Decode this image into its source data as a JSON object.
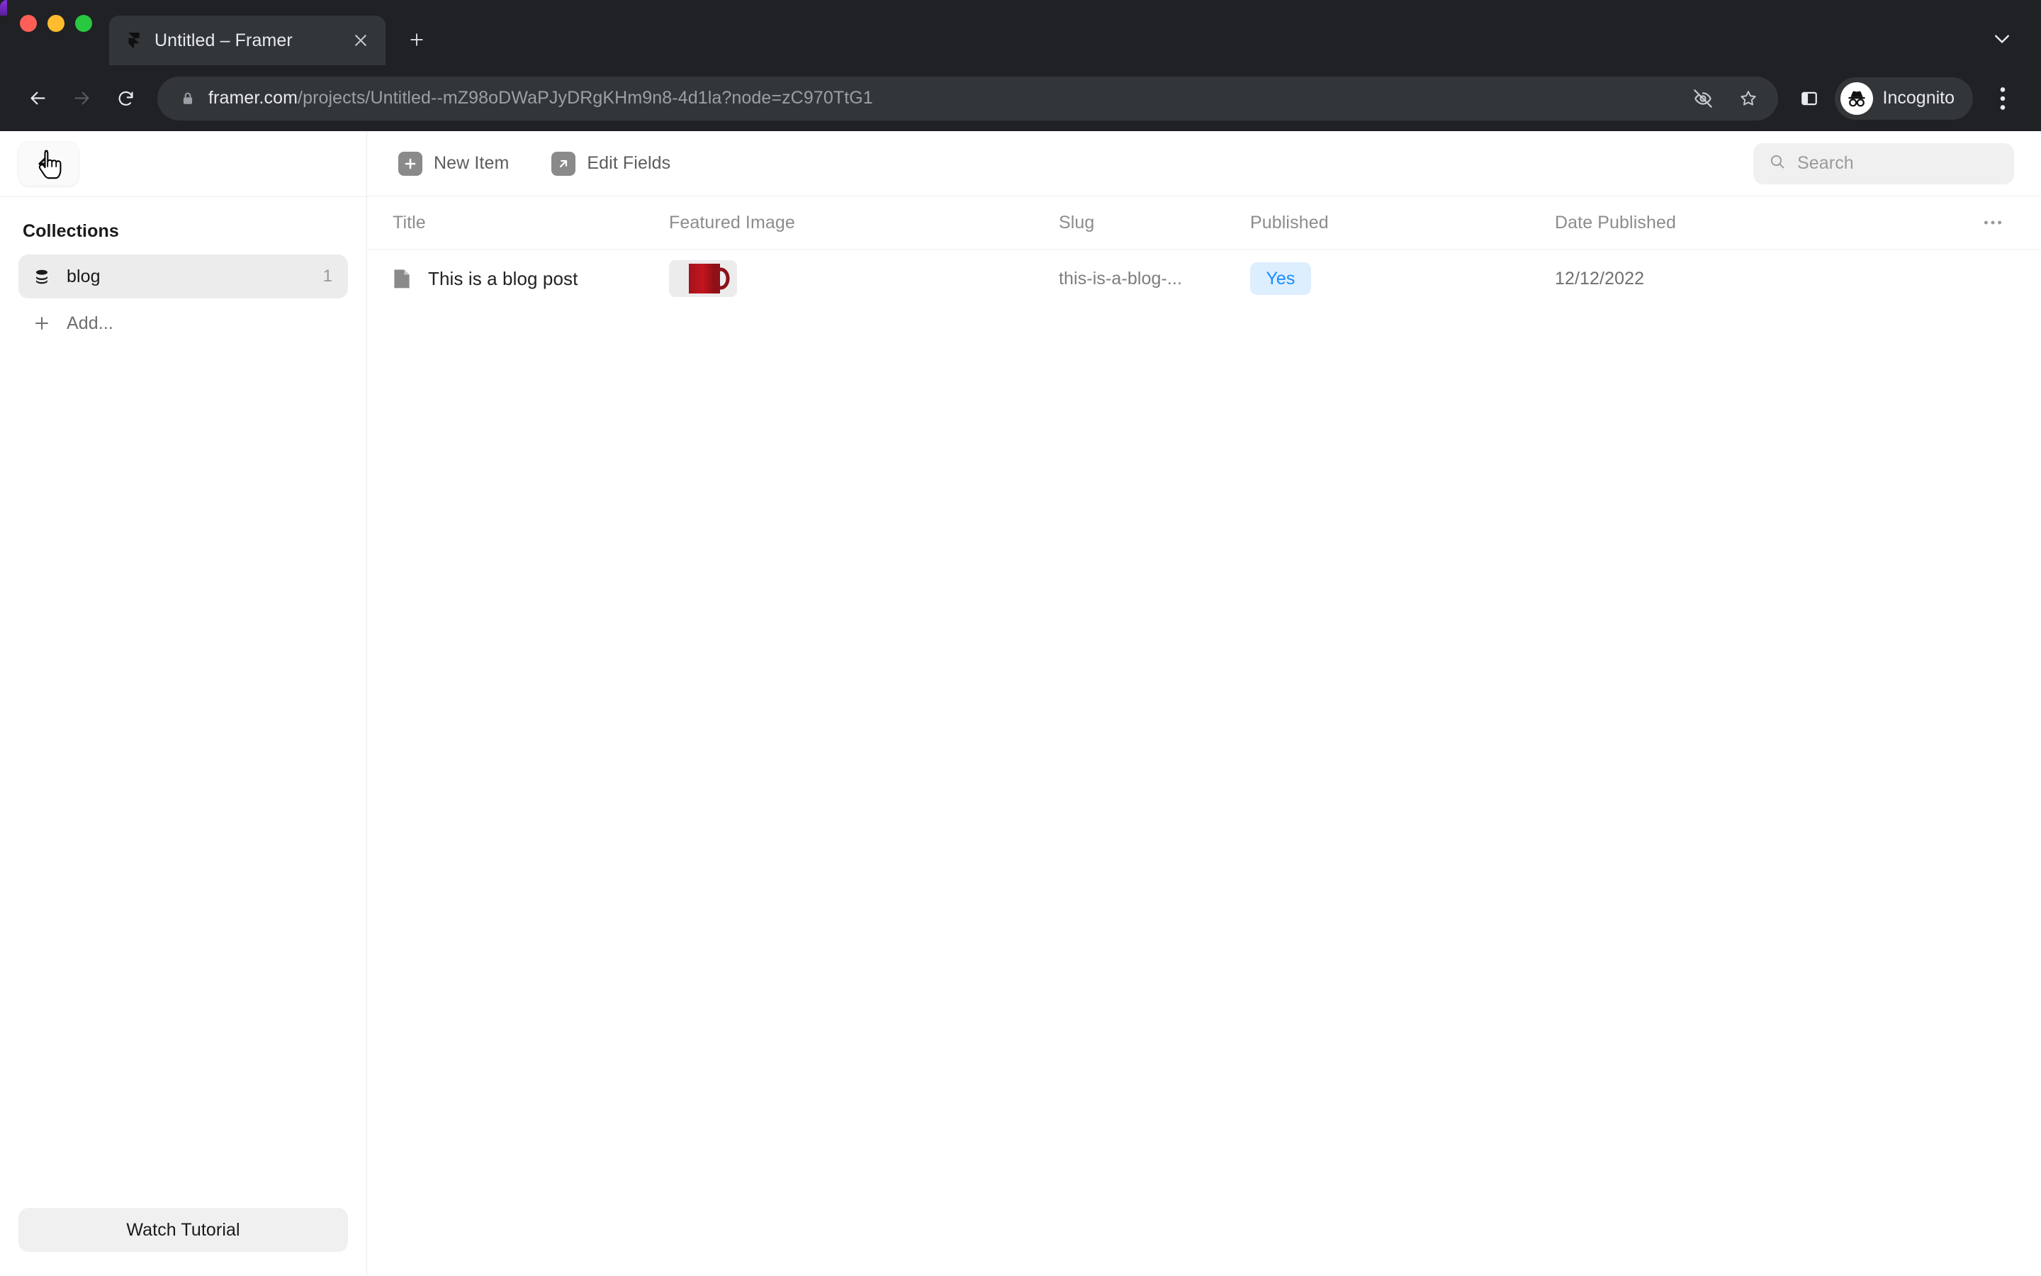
{
  "browser": {
    "tab": {
      "title": "Untitled – Framer",
      "favicon_icon": "framer-logo-icon",
      "close_icon": "close-icon"
    },
    "new_tab_icon": "plus-icon",
    "tabstrip_chevron_icon": "chevron-down-icon",
    "nav": {
      "back_icon": "arrow-left-icon",
      "forward_icon": "arrow-right-icon",
      "reload_icon": "reload-icon"
    },
    "omnibox": {
      "lock_icon": "lock-icon",
      "host": "framer.com",
      "path": "/projects/Untitled--mZ98oDWaPJyDRgKHm9n8-4d1la?node=zC970TtG1",
      "full_url": "framer.com/projects/Untitled--mZ98oDWaPJyDRgKHm9n8-4d1la?node=zC970TtG1",
      "no_tracking_icon": "eye-slash-icon",
      "bookmark_icon": "star-icon"
    },
    "side_panel_icon": "side-panel-icon",
    "profile": {
      "label": "Incognito",
      "avatar_icon": "incognito-icon"
    },
    "menu_icon": "kebab-menu-icon"
  },
  "app": {
    "back_button": {
      "icon": "arrow-left-icon"
    },
    "sidebar": {
      "heading": "Collections",
      "items": [
        {
          "label": "blog",
          "count": "1",
          "icon": "database-stack-icon",
          "selected": true
        }
      ],
      "add": {
        "label": "Add...",
        "icon": "plus-icon"
      },
      "watch_tutorial_label": "Watch Tutorial"
    },
    "toolbar": {
      "new_item_label": "New Item",
      "new_item_icon": "plus-icon",
      "edit_fields_label": "Edit Fields",
      "edit_fields_icon": "arrow-up-right-icon"
    },
    "search": {
      "placeholder": "Search",
      "value": "",
      "icon": "search-icon"
    },
    "table": {
      "more_icon": "ellipsis-horizontal-icon",
      "columns": [
        {
          "key": "title",
          "label": "Title"
        },
        {
          "key": "featured_image",
          "label": "Featured Image"
        },
        {
          "key": "slug",
          "label": "Slug"
        },
        {
          "key": "published",
          "label": "Published"
        },
        {
          "key": "date_published",
          "label": "Date Published"
        }
      ],
      "rows": [
        {
          "icon": "document-icon",
          "title": "This is a blog post",
          "featured_image_alt": "red-coffee-mug-thumbnail",
          "slug": "this-is-a-blog-...",
          "published": "Yes",
          "date_published": "12/12/2022"
        }
      ]
    },
    "colors": {
      "accent_blue": "#1a8cff",
      "badge_bg": "#ddeeff",
      "selected_bg": "#ececec",
      "divider": "#ededed",
      "thumb_red": "#b5121b"
    }
  }
}
